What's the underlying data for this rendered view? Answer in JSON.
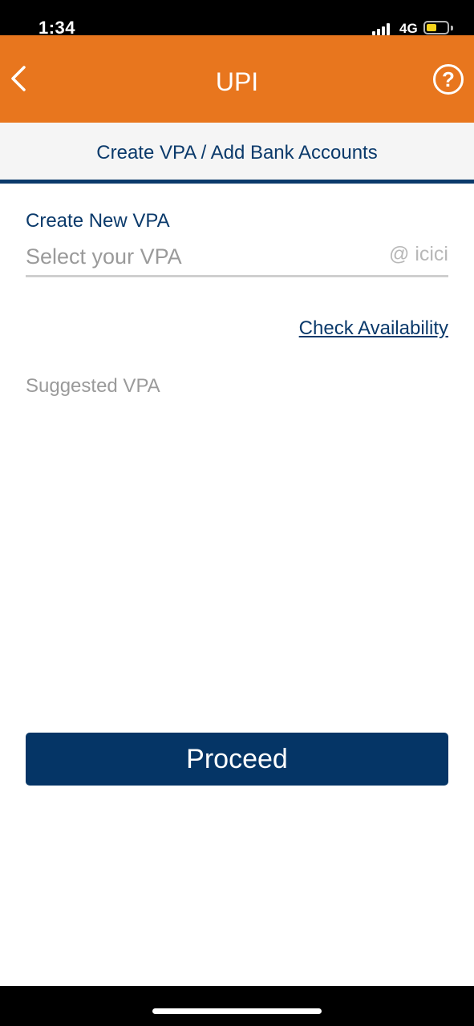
{
  "status_bar": {
    "time": "1:34",
    "network": "4G",
    "battery_color": "#f5d31c"
  },
  "header": {
    "title": "UPI",
    "back_icon": "chevron-left-icon",
    "help_icon": "question-circle-icon",
    "help_glyph": "?",
    "background_color": "#e8761e"
  },
  "section_tab": {
    "label": "Create VPA / Add Bank Accounts"
  },
  "form": {
    "field_label": "Create New VPA",
    "vpa_placeholder": "Select your VPA",
    "vpa_value": "",
    "vpa_suffix": "@ icici",
    "check_availability": "Check Availability",
    "suggested_label": "Suggested VPA"
  },
  "actions": {
    "proceed": "Proceed",
    "button_color": "#053566"
  }
}
